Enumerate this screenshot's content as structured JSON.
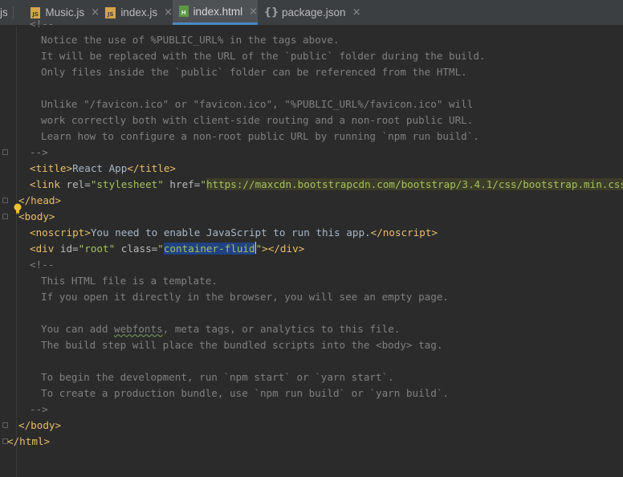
{
  "tabs": [
    {
      "label": "js",
      "icon": "none",
      "active": false
    },
    {
      "label": "Music.js",
      "icon": "js-file-icon",
      "close": "×"
    },
    {
      "label": "index.js",
      "icon": "js-file-icon",
      "close": "×"
    },
    {
      "label": "index.html",
      "icon": "html-file-icon",
      "close": "×",
      "active": true
    },
    {
      "label": "package.json",
      "icon": "json-file-icon",
      "close": "×"
    }
  ],
  "file_icon_text": {
    "js": "JS",
    "html": "H",
    "json": "{}"
  },
  "code": {
    "l1": "<!--",
    "l2": "Notice the use of %PUBLIC_URL% in the tags above.",
    "l3": "It will be replaced with the URL of the `public` folder during the build.",
    "l4": "Only files inside the `public` folder can be referenced from the HTML.",
    "l6": "Unlike \"/favicon.ico\" or \"favicon.ico\", \"%PUBLIC_URL%/favicon.ico\" will",
    "l7": "work correctly both with client-side routing and a non-root public URL.",
    "l8": "Learn how to configure a non-root public URL by running `npm run build`.",
    "l9": "-->",
    "title_open": "<title>",
    "title_text": "React App",
    "title_close": "</title>",
    "link_open": "<link ",
    "link_rel_attr": "rel=",
    "link_rel_val": "\"stylesheet\"",
    "link_href_attr": " href=",
    "link_q1": "\"",
    "link_url": "https://maxcdn.bootstrapcdn.com/bootstrap/3.4.1/css/bootstrap.min.css",
    "link_q2": "\"",
    "link_close": ">",
    "head_close": "</head>",
    "body_open": "<body>",
    "noscript_open": "<noscript>",
    "noscript_text": "You need to enable JavaScript to run this app.",
    "noscript_close": "</noscript>",
    "div_open": "<div ",
    "div_id_attr": "id=",
    "div_id_val": "\"root\"",
    "div_class_attr": " class=",
    "div_q1": "\"",
    "div_class_val": "container-fluid",
    "div_q2": "\"",
    "div_close": "></div>",
    "c2_open": "<!--",
    "c2_l1": "This HTML file is a template.",
    "c2_l2": "If you open it directly in the browser, you will see an empty page.",
    "c2_l4a": "You can add ",
    "c2_l4b": "webfonts",
    "c2_l4c": ", meta tags, or analytics to this file.",
    "c2_l5": "The build step will place the bundled scripts into the <body> tag.",
    "c2_l7": "To begin the development, run `npm start` or `yarn start`.",
    "c2_l8": "To create a production bundle, use `npm run build` or `yarn build`.",
    "c2_close": "-->",
    "body_close": "</body>",
    "html_close": "</html>"
  }
}
